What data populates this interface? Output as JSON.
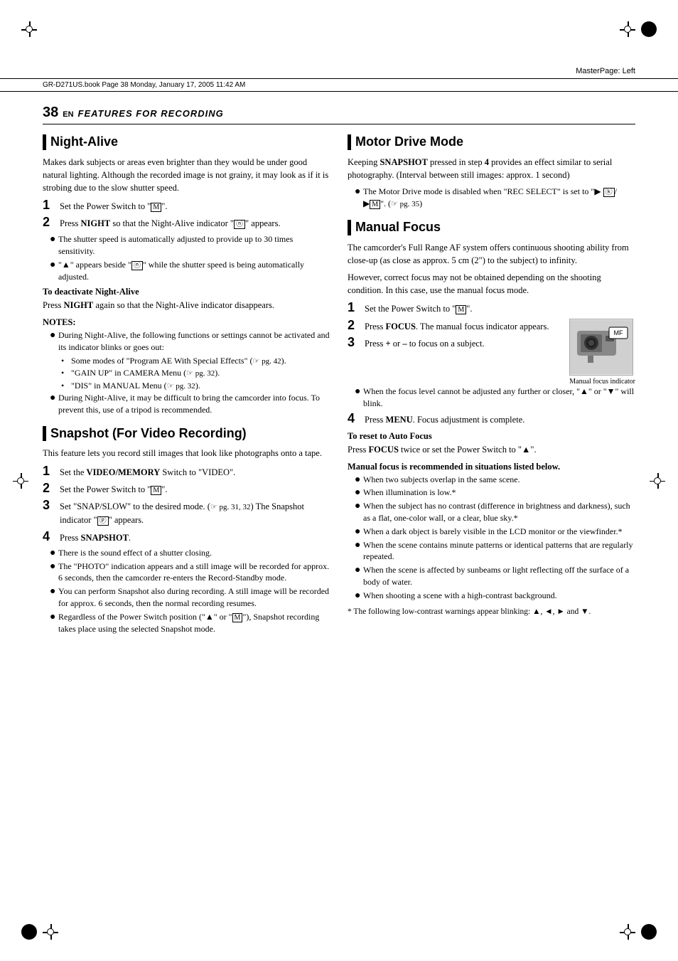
{
  "page": {
    "masterpage_label": "MasterPage: Left",
    "header_bar_text": "GR-D271US.book  Page 38  Monday, January 17, 2005  11:42 AM",
    "page_number": "38",
    "page_number_superscript": "EN",
    "section_title": "FEATURES FOR RECORDING"
  },
  "sections": {
    "night_alive": {
      "heading": "Night-Alive",
      "intro": "Makes dark subjects or areas even brighter than they would be under good natural lighting. Although the recorded image is not grainy, it may look as if it is strobing due to the slow shutter speed.",
      "step1": "Set the Power Switch to \"ⓜ\".",
      "step2_prefix": "Press ",
      "step2_bold": "NIGHT",
      "step2_suffix": " so that the Night-Alive indicator \"ⓝ\" appears.",
      "bullets": [
        "The shutter speed is automatically adjusted to provide up to 30 times sensitivity.",
        "\"▲\" appears beside \"ⓝ\" while the shutter speed is being automatically adjusted."
      ],
      "deactivate_heading": "To deactivate Night-Alive",
      "deactivate_text": "Press NIGHT again so that the Night-Alive indicator disappears.",
      "notes_heading": "NOTES:",
      "notes": [
        "During Night-Alive, the following functions or settings cannot be activated and its indicator blinks or goes out:",
        "Some modes of “Program AE With Special Effects” (↗ pg. 42).",
        "“GAIN UP” in CAMERA Menu (↗ pg. 32).",
        "“DIS” in MANUAL Menu (↗ pg. 32).",
        "During Night-Alive, it may be difficult to bring the camcorder into focus. To prevent this, use of a tripod is recommended."
      ]
    },
    "snapshot": {
      "heading": "Snapshot (For Video Recording)",
      "intro": "This feature lets you record still images that look like photographs onto a tape.",
      "step1_prefix": "Set the ",
      "step1_bold": "VIDEO/MEMORY",
      "step1_suffix": " Switch to “VIDEO”.",
      "step2": "Set the Power Switch to \"ⓜ\".",
      "step3_prefix": "Set “SNAP/SLOW” to the desired mode. (↗ pg. 31, 32) The Snapshot indicator “ⓟ” appears.",
      "step4_prefix": "Press ",
      "step4_bold": "SNAPSHOT",
      "step4_suffix": ".",
      "step4_bullets": [
        "There is the sound effect of a shutter closing.",
        "The “PHOTO” indication appears and a still image will be recorded for approx. 6 seconds, then the camcorder re-enters the Record-Standby mode.",
        "You can perform Snapshot also during recording. A still image will be recorded for approx. 6 seconds, then the normal recording resumes.",
        "Regardless of the Power Switch position (“▲” or “ⓜ”), Snapshot recording takes place using the selected Snapshot mode."
      ]
    },
    "motor_drive": {
      "heading": "Motor Drive Mode",
      "intro_prefix": "Keeping ",
      "intro_bold": "SNAPSHOT",
      "intro_suffix": " pressed in step ",
      "step_bold": "4",
      "intro_end": " provides an effect similar to serial photography. (Interval between still images: approx. 1 second)",
      "bullet": "The Motor Drive mode is disabled when “REC SELECT” is set to “► ⓚ/►ⓜ”. (↗ pg. 35)"
    },
    "manual_focus": {
      "heading": "Manual Focus",
      "intro": "The camcorder’s Full Range AF system offers continuous shooting ability from close-up (as close as approx. 5 cm (2”) to the subject) to infinity.",
      "intro2": "However, correct focus may not be obtained depending on the shooting condition. In this case, use the manual focus mode.",
      "step1": "Set the Power Switch to \"ⓜ\".",
      "step2_prefix": "Press ",
      "step2_bold": "FOCUS",
      "step2_suffix": ". The manual focus indicator appears.",
      "step3_prefix": "Press ",
      "step3_bold_plus": "+",
      "step3_or": " or ",
      "step3_bold_minus": "–",
      "step3_suffix": " to focus on a subject.",
      "step3_bullet": "When the focus level cannot be adjusted any further or closer, “▲” or “▼” will blink.",
      "step4_prefix": "Press ",
      "step4_bold": "MENU",
      "step4_suffix": ". Focus adjustment is complete.",
      "reset_heading": "To reset to Auto Focus",
      "reset_text": "Press FOCUS twice or set the Power Switch to “▲”.",
      "recommended_heading": "Manual focus is recommended in situations listed below.",
      "recommended_bullets": [
        "When two subjects overlap in the same scene.",
        "When illumination is low.*",
        "When the subject has no contrast (difference in brightness and darkness), such as a flat, one-color wall, or a clear, blue sky.*",
        "When a dark object is barely visible in the LCD monitor or the viewfinder.*",
        "When the scene contains minute patterns or identical patterns that are regularly repeated.",
        "When the scene is affected by sunbeams or light reflecting off the surface of a body of water.",
        "When shooting a scene with a high-contrast background."
      ],
      "footnote": "* The following low-contrast warnings appear blinking: ▲, ◄, ► and ▼.",
      "image_caption": "Manual focus indicator"
    }
  }
}
